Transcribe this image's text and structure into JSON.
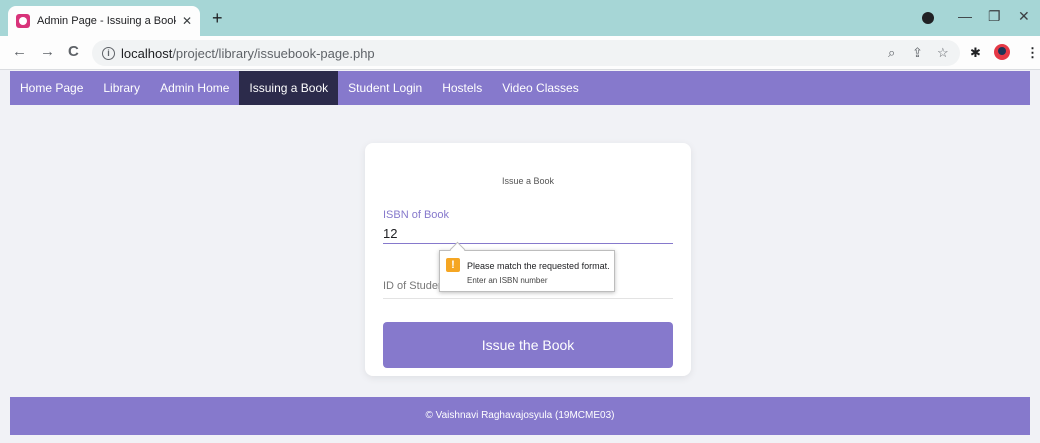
{
  "browser": {
    "tab_title": "Admin Page - Issuing a Book | Lil",
    "tab_close": "✕",
    "new_tab": "+",
    "url_host": "localhost",
    "url_path": "/project/library/issuebook-page.php",
    "back": "←",
    "forward": "→",
    "reload": "C",
    "minimize": "—",
    "restore": "❐",
    "close": "✕"
  },
  "nav": {
    "items": [
      {
        "label": "Home Page"
      },
      {
        "label": "Library"
      },
      {
        "label": "Admin Home"
      },
      {
        "label": "Issuing a Book",
        "active": true
      },
      {
        "label": "Student Login"
      },
      {
        "label": "Hostels"
      },
      {
        "label": "Video Classes"
      }
    ]
  },
  "form": {
    "title": "Issue a Book",
    "isbn_label": "ISBN of Book",
    "isbn_value": "12",
    "student_placeholder": "ID of Student",
    "submit_label": "Issue the Book"
  },
  "tooltip": {
    "message": "Please match the requested format.",
    "hint": "Enter an ISBN number"
  },
  "footer": {
    "text": "© Vaishnavi Raghavajosyula (19MCME03)"
  },
  "colors": {
    "accent": "#8679cc",
    "nav_active": "#2c2b4b",
    "warning": "#f5a623"
  }
}
